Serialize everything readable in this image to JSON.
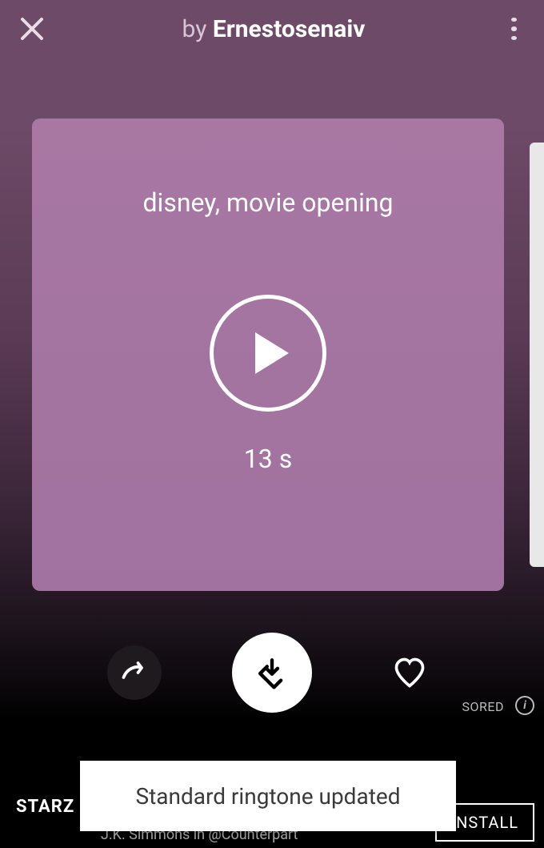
{
  "header": {
    "by_label": "by",
    "author": "Ernestosenaiv"
  },
  "card": {
    "title": "disney, movie opening",
    "duration": "13 s"
  },
  "next_card_visible": true,
  "actions": {
    "share": "share",
    "download": "download",
    "favorite": "favorite"
  },
  "toast": {
    "message": "Standard ringtone updated"
  },
  "ad": {
    "logo": "STARZ",
    "subtitle": "J.K. Simmons in @Counterpart",
    "sponsored_label": "SORED",
    "install_label": "INSTALL"
  }
}
